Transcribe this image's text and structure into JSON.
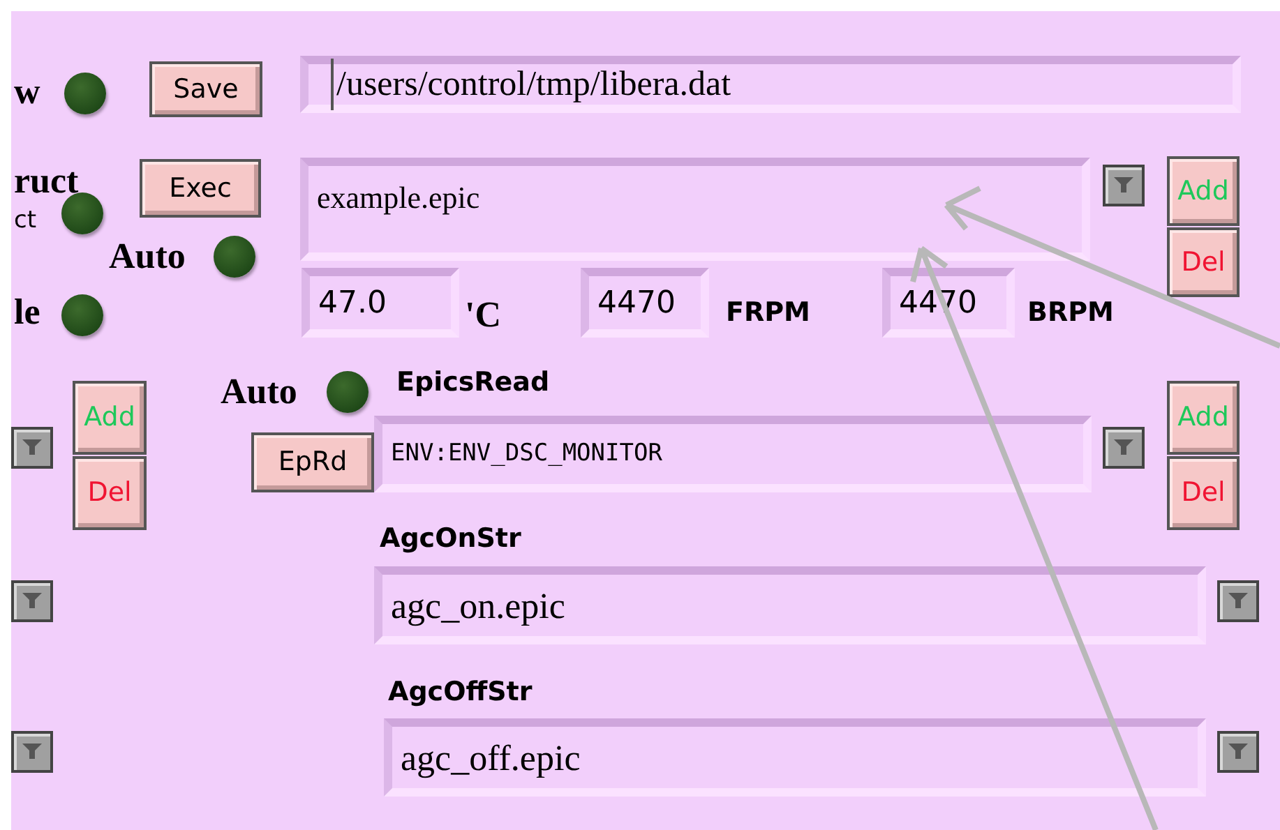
{
  "labels": [
    {
      "kind": "serif",
      "text": "w"
    },
    {
      "kind": "serif",
      "text": "ruct"
    },
    {
      "kind": "small",
      "text": "ct"
    },
    {
      "kind": "serif",
      "text": "Auto"
    },
    {
      "kind": "serif",
      "text": "le"
    },
    {
      "kind": "serif",
      "text": "'C"
    },
    {
      "kind": "bold",
      "text": "FRPM"
    },
    {
      "kind": "bold",
      "text": "BRPM"
    },
    {
      "kind": "serif",
      "text": "Auto"
    },
    {
      "kind": "bold",
      "text": "EpicsRead"
    },
    {
      "kind": "bold",
      "text": "AgcOnStr"
    },
    {
      "kind": "bold",
      "text": "AgcOffStr"
    }
  ],
  "leds": [
    {
      "on": false
    },
    {
      "on": false
    },
    {
      "on": false
    },
    {
      "on": false
    },
    {
      "on": false
    }
  ],
  "buttons": [
    {
      "kind": "plain",
      "label": "Save"
    },
    {
      "kind": "plain",
      "label": "Exec"
    },
    {
      "kind": "add",
      "label": "Add"
    },
    {
      "kind": "del",
      "label": "Del"
    },
    {
      "kind": "add",
      "label": "Add"
    },
    {
      "kind": "del",
      "label": "Del"
    },
    {
      "kind": "plain",
      "label": "EpRd"
    },
    {
      "kind": "add",
      "label": "Add"
    },
    {
      "kind": "del",
      "label": "Del"
    }
  ],
  "fields": [
    {
      "kind": "file",
      "value": "/users/control/tmp/libera.dat"
    },
    {
      "kind": "area",
      "value": "example.epic"
    },
    {
      "kind": "num",
      "value": "47.0"
    },
    {
      "kind": "num",
      "value": "4470"
    },
    {
      "kind": "num",
      "value": "4470"
    },
    {
      "kind": "mono",
      "value": "ENV:ENV_DSC_MONITOR"
    },
    {
      "kind": "text",
      "value": "agc_on.epic"
    },
    {
      "kind": "text",
      "value": "agc_off.epic"
    }
  ]
}
